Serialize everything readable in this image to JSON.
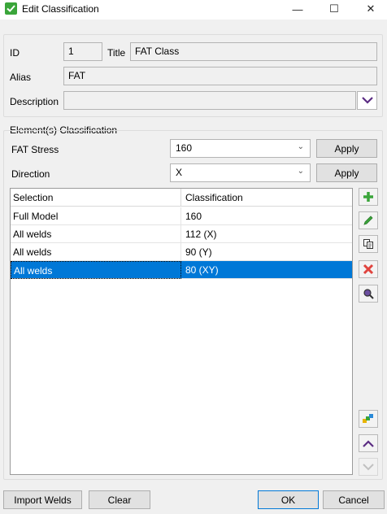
{
  "window": {
    "title": "Edit Classification",
    "minimize_glyph": "—",
    "maximize_glyph": "☐",
    "close_glyph": "✕"
  },
  "general": {
    "id_label": "ID",
    "id_value": "1",
    "title_label": "Title",
    "title_value": "FAT Class",
    "alias_label": "Alias",
    "alias_value": "FAT",
    "description_label": "Description",
    "description_value": ""
  },
  "elements": {
    "group_label": "Element(s) Classification",
    "fat_stress_label": "FAT Stress",
    "fat_stress_value": "160",
    "direction_label": "Direction",
    "direction_value": "X",
    "apply_label": "Apply"
  },
  "table": {
    "headers": [
      "Selection",
      "Classification"
    ],
    "rows": [
      {
        "selection": "Full Model",
        "classification": "160"
      },
      {
        "selection": "All welds",
        "classification": "112 (X)"
      },
      {
        "selection": "All welds",
        "classification": "90 (Y)"
      },
      {
        "selection": "All welds",
        "classification": "80 (XY)"
      }
    ],
    "selected_index": 3
  },
  "tools": {
    "add_icon": "add-icon",
    "edit_icon": "edit-icon",
    "copy_icon": "copy-icon",
    "delete_icon": "delete-icon",
    "find_icon": "find-icon",
    "colors_icon": "colors-icon",
    "up_icon": "chevron-up-icon",
    "down_icon": "chevron-down-icon"
  },
  "footer": {
    "import_label": "Import Welds",
    "clear_label": "Clear",
    "ok_label": "OK",
    "cancel_label": "Cancel"
  },
  "colors": {
    "accent": "#0078d7",
    "add": "#3aa53a",
    "delete": "#e0443e",
    "edit": "#3aa53a"
  }
}
